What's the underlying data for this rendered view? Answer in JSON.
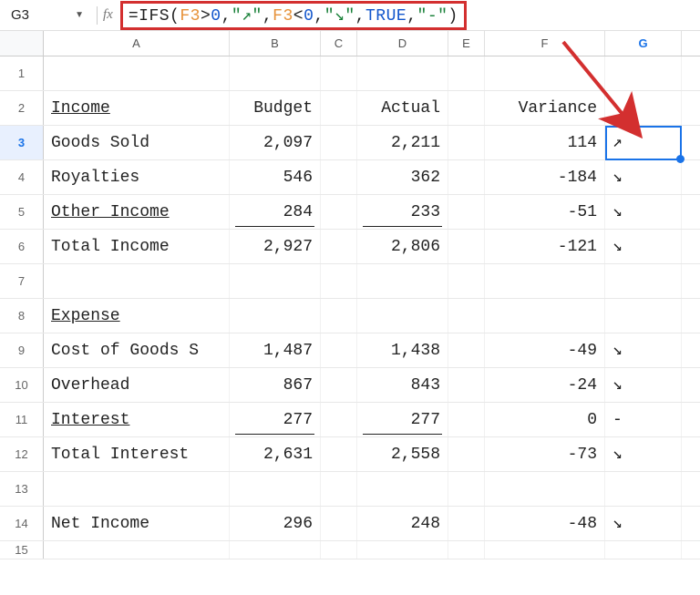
{
  "namebox": {
    "value": "G3"
  },
  "formula": {
    "eq": "=",
    "fn": "IFS",
    "open": "(",
    "ref1": "F3",
    "cmp1": ">",
    "num0a": "0",
    "c1": ",",
    "str_up": "\"↗\"",
    "c2": ",",
    "ref2": "F3",
    "cmp2": "<",
    "num0b": "0",
    "c3": ",",
    "str_dn": "\"↘\"",
    "c4": ",",
    "bool": "TRUE",
    "c5": ",",
    "str_dash": "\"-\"",
    "close": ")"
  },
  "columns": {
    "A": "A",
    "B": "B",
    "C": "C",
    "D": "D",
    "E": "E",
    "F": "F",
    "G": "G"
  },
  "rows": {
    "r1": "1",
    "r2": "2",
    "r3": "3",
    "r4": "4",
    "r5": "5",
    "r6": "6",
    "r7": "7",
    "r8": "8",
    "r9": "9",
    "r10": "10",
    "r11": "11",
    "r12": "12",
    "r13": "13",
    "r14": "14",
    "r15": "15"
  },
  "data": {
    "r2": {
      "a": "Income",
      "b": "Budget",
      "d": "Actual",
      "f": "Variance"
    },
    "r3": {
      "a": "Goods Sold",
      "b": "2,097",
      "d": "2,211",
      "f": "114",
      "g": "↗"
    },
    "r4": {
      "a": "Royalties",
      "b": "546",
      "d": "362",
      "f": "-184",
      "g": "↘"
    },
    "r5": {
      "a": "Other Income",
      "b": "284",
      "d": "233",
      "f": "-51",
      "g": "↘"
    },
    "r6": {
      "a": "Total Income",
      "b": "2,927",
      "d": "2,806",
      "f": "-121",
      "g": "↘"
    },
    "r8": {
      "a": "Expense"
    },
    "r9": {
      "a": "Cost of Goods S",
      "b": "1,487",
      "d": "1,438",
      "f": "-49",
      "g": "↘"
    },
    "r10": {
      "a": "Overhead",
      "b": "867",
      "d": "843",
      "f": "-24",
      "g": "↘"
    },
    "r11": {
      "a": "Interest",
      "b": "277",
      "d": "277",
      "f": "0",
      "g": "-"
    },
    "r12": {
      "a": "Total Interest",
      "b": "2,631",
      "d": "2,558",
      "f": "-73",
      "g": "↘"
    },
    "r14": {
      "a": "Net Income",
      "b": "296",
      "d": "248",
      "f": "-48",
      "g": "↘"
    }
  }
}
